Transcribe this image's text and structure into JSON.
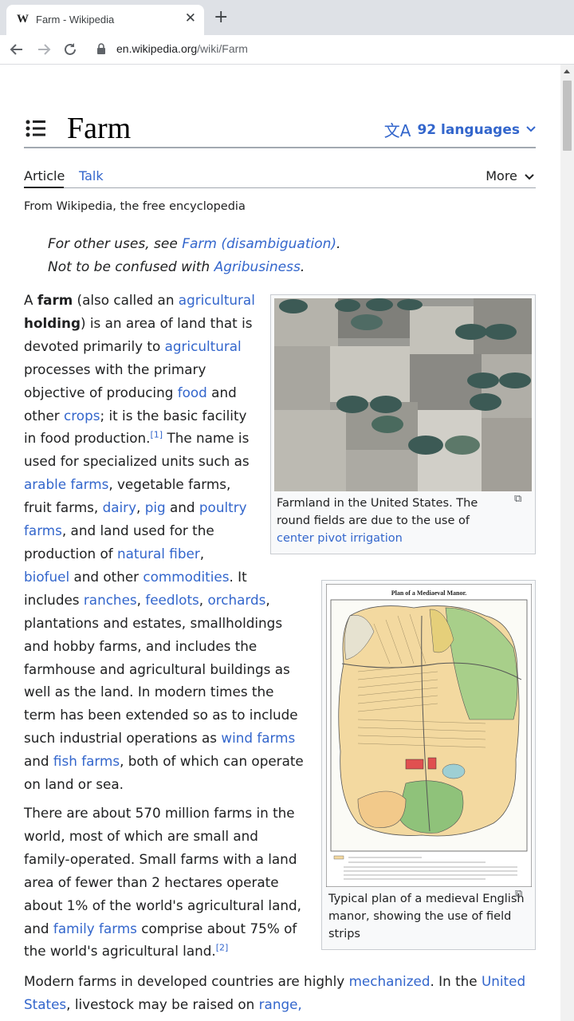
{
  "browser": {
    "tab_favicon": "W",
    "tab_title": "Farm - Wikipedia",
    "url_host": "en.wikipedia.org",
    "url_path": "/wiki/Farm"
  },
  "article": {
    "title": "Farm",
    "languages_label": "92 languages",
    "tab_article": "Article",
    "tab_talk": "Talk",
    "more_label": "More",
    "tagline": "From Wikipedia, the free encyclopedia",
    "hatnote1_prefix": "For other uses, see ",
    "hatnote1_link": "Farm (disambiguation)",
    "hatnote1_suffix": ".",
    "hatnote2_prefix": "Not to be confused with ",
    "hatnote2_link": "Agribusiness",
    "hatnote2_suffix": "."
  },
  "figure1": {
    "caption_text": "Farmland in the United States. The round fields are due to the use of ",
    "caption_link": "center pivot irrigation"
  },
  "figure2": {
    "image_title": "Plan of a Mediaeval Manor.",
    "caption": "Typical plan of a medieval English manor, showing the use of field strips"
  },
  "paragraph3": {
    "prefix": "Modern farms in developed countries are highly ",
    "link1": "mechanized",
    "mid": ". In the ",
    "link2": "United States",
    "mid2": ", livestock may be raised on ",
    "link3": "range,"
  },
  "colors": {
    "link": "#3366cc",
    "text": "#202122",
    "rule": "#a2a9b1"
  }
}
